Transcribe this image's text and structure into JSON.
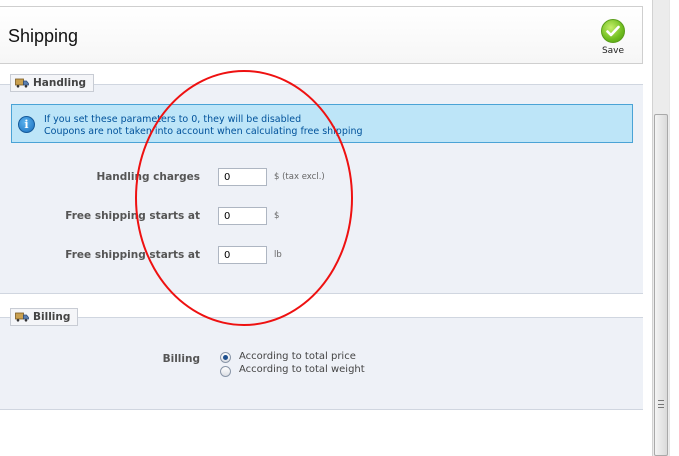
{
  "header": {
    "title": "Shipping",
    "save_label": "Save"
  },
  "handling": {
    "legend": "Handling",
    "info_line1": "If you set these parameters to 0, they will be disabled",
    "info_line2": "Coupons are not taken into account when calculating free shipping",
    "fields": [
      {
        "label": "Handling charges",
        "value": "0",
        "unit": "$ (tax excl.)"
      },
      {
        "label": "Free shipping starts at",
        "value": "0",
        "unit": "$"
      },
      {
        "label": "Free shipping starts at",
        "value": "0",
        "unit": "lb"
      }
    ]
  },
  "billing": {
    "legend": "Billing",
    "label": "Billing",
    "options": [
      {
        "label": "According to total price",
        "selected": true
      },
      {
        "label": "According to total weight",
        "selected": false
      }
    ]
  },
  "colors": {
    "info_bg": "#bde5f8",
    "info_text": "#00529b",
    "fieldset_bg": "#eef1f7",
    "annotation": "#ee1111",
    "save_green": "#6fbd1f"
  },
  "icons": {
    "save": "checkmark-circle-icon",
    "info": "info-icon",
    "legend": "truck-icon"
  }
}
